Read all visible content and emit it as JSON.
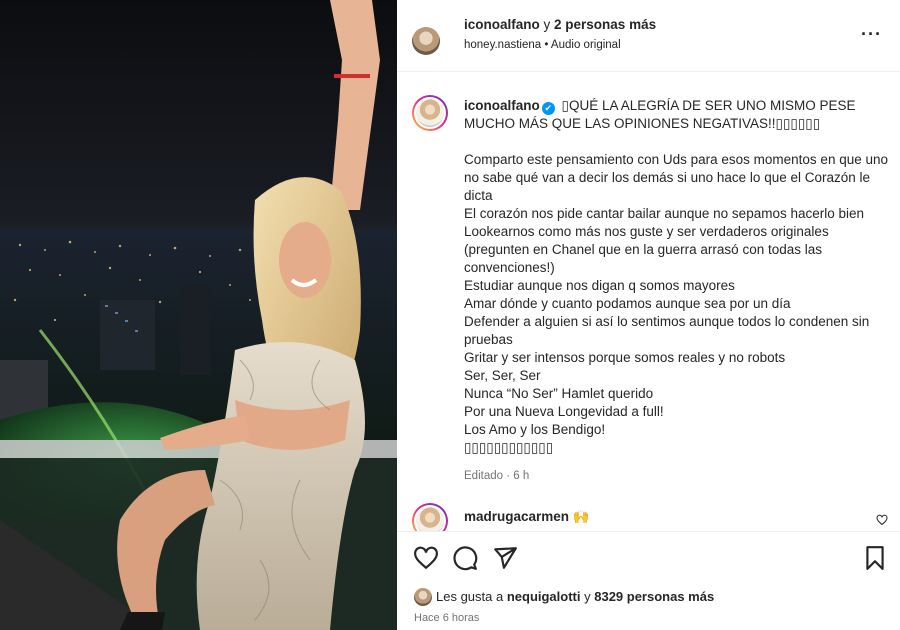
{
  "post": {
    "media_alt": "woman raising arm on balcony at night over city lights"
  },
  "header": {
    "author": "iconoalfano",
    "connector": " y ",
    "others": "2 personas más",
    "subtitle": "honey.nastiena • Audio original",
    "more_icon": "···"
  },
  "caption": {
    "username": "iconoalfano",
    "verified_icon": "✔",
    "headline": "\u0000QUÉ LA ALEGRÍA DE SER UNO MISMO PESE MUCHO MÁS QUE LAS OPINIONES NEGATIVAS!!▯▯▯▯▯▯",
    "body": "Comparto este pensamiento con Uds para esos momentos en que uno no sabe qué van a decir los demás si uno hace lo que el Corazón le dicta\nEl corazón nos pide cantar bailar aunque no sepamos hacerlo bien\nLookearnos como más nos guste y ser verdaderos originales (pregunten en Chanel que en la guerra arrasó con todas las convenciones!)\nEstudiar aunque nos digan q somos mayores\nAmar dónde y cuanto podamos aunque sea por un día\nDefender a alguien si así lo sentimos aunque todos lo condenen sin pruebas\nGritar y ser intensos porque somos reales y no robots\nSer, Ser, Ser\nNunca “No Ser” Hamlet querido\nPor una Nueva Longevidad a full!\nLos Amo y los Bendigo!\n▯▯▯▯▯▯▯▯▯▯▯▯",
    "edited": "Editado · 6 h"
  },
  "comment": {
    "username": "madrugacarmen",
    "emoji": "🙌"
  },
  "actions": {
    "likes_prefix": "Les gusta a ",
    "likes_user": "nequigalotti",
    "likes_mid": " y ",
    "likes_count": "8329 personas más",
    "time": "Hace 6 horas"
  },
  "colors": {
    "accent": "#0095f6",
    "muted": "#737373",
    "text": "#262626"
  }
}
